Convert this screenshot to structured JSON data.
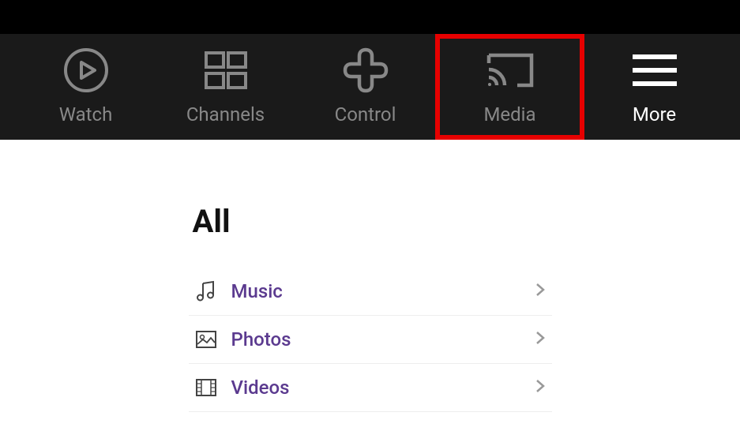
{
  "nav": {
    "items": [
      {
        "id": "watch",
        "label": "Watch",
        "active": false,
        "highlighted": false
      },
      {
        "id": "channels",
        "label": "Channels",
        "active": false,
        "highlighted": false
      },
      {
        "id": "control",
        "label": "Control",
        "active": false,
        "highlighted": false
      },
      {
        "id": "media",
        "label": "Media",
        "active": false,
        "highlighted": true
      },
      {
        "id": "more",
        "label": "More",
        "active": true,
        "highlighted": false
      }
    ]
  },
  "section": {
    "title": "All",
    "items": [
      {
        "id": "music",
        "label": "Music"
      },
      {
        "id": "photos",
        "label": "Photos"
      },
      {
        "id": "videos",
        "label": "Videos"
      }
    ]
  },
  "colors": {
    "highlight_border": "#e60000",
    "nav_bg": "#1a1a1a",
    "list_label": "#5b3a8f"
  }
}
